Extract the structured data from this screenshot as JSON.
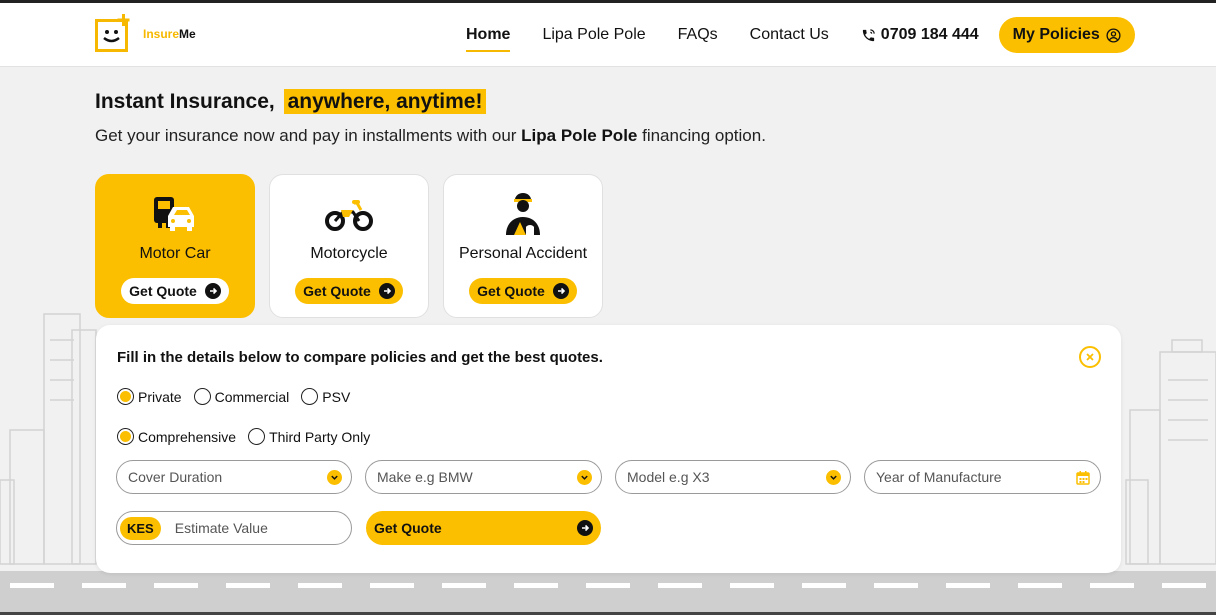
{
  "logo": {
    "part1": "Insure",
    "part2": "Me"
  },
  "nav": {
    "items": [
      {
        "label": "Home",
        "active": true
      },
      {
        "label": "Lipa Pole Pole",
        "active": false
      },
      {
        "label": "FAQs",
        "active": false
      },
      {
        "label": "Contact Us",
        "active": false
      }
    ],
    "phone": "0709 184 444",
    "policies_label": "My Policies"
  },
  "hero": {
    "title": "Instant Insurance,",
    "title_highlight": "anywhere, anytime!",
    "subtitle_pre": "Get your insurance now and pay in installments with our ",
    "subtitle_bold": "Lipa Pole Pole",
    "subtitle_post": " financing option."
  },
  "cards": [
    {
      "label": "Motor Car",
      "button": "Get Quote",
      "icon": "car-icon",
      "selected": true
    },
    {
      "label": "Motorcycle",
      "button": "Get Quote",
      "icon": "motorcycle-icon",
      "selected": false
    },
    {
      "label": "Personal Accident",
      "button": "Get Quote",
      "icon": "person-icon",
      "selected": false
    }
  ],
  "form": {
    "title": "Fill in the details below to compare policies and get the best quotes.",
    "usage_options": [
      {
        "label": "Private",
        "checked": true
      },
      {
        "label": "Commercial",
        "checked": false
      },
      {
        "label": "PSV",
        "checked": false
      }
    ],
    "cover_options": [
      {
        "label": "Comprehensive",
        "checked": true
      },
      {
        "label": "Third Party Only",
        "checked": false
      }
    ],
    "fields": {
      "cover_duration": "Cover Duration",
      "make": "Make e.g BMW",
      "model": "Model e.g X3",
      "year": "Year of Manufacture",
      "currency": "KES",
      "estimate": "Estimate Value"
    },
    "submit_label": "Get Quote"
  },
  "colors": {
    "accent": "#fbbf00",
    "text": "#111111",
    "background": "#f1f1f1"
  }
}
